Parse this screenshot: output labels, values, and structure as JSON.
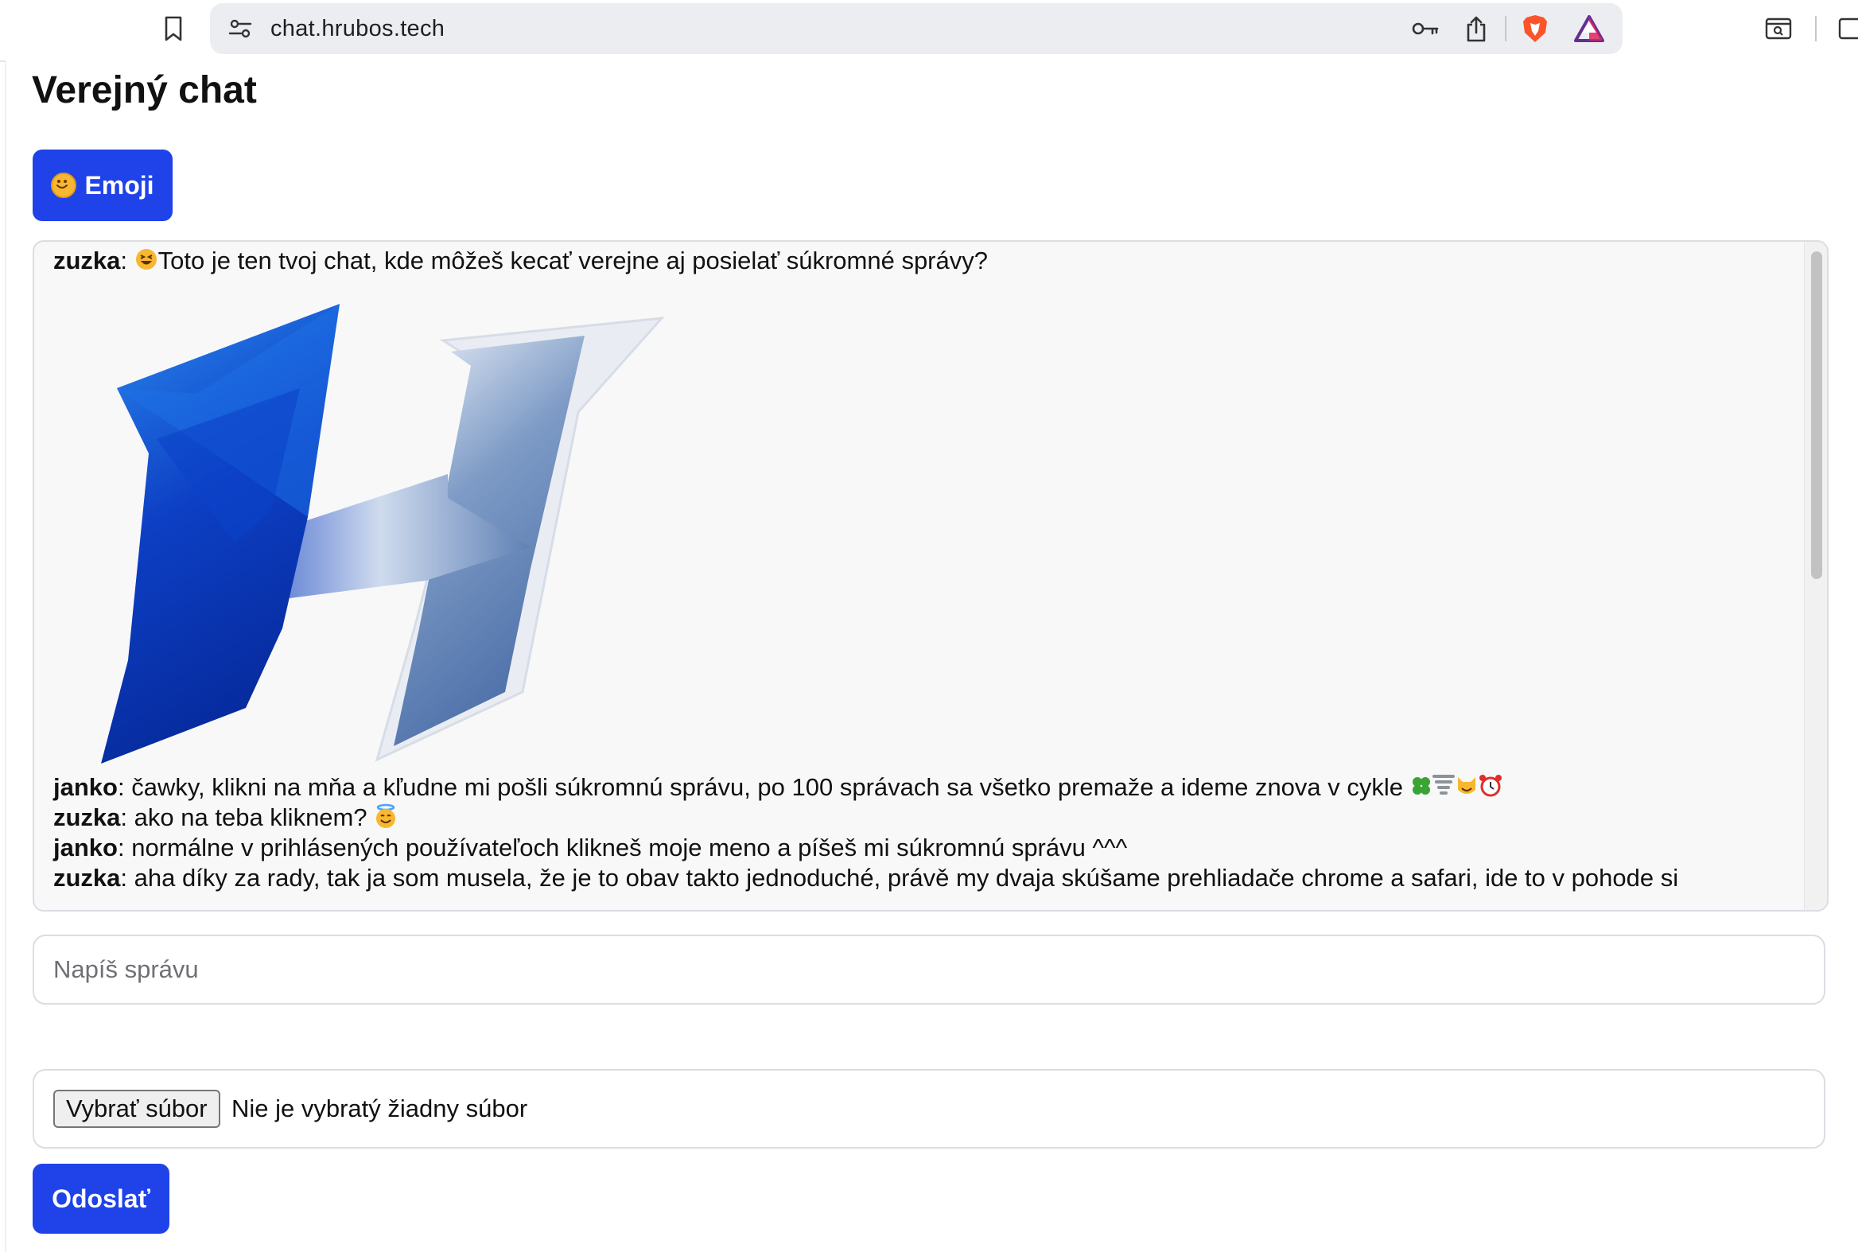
{
  "browser": {
    "url": "chat.hrubos.tech"
  },
  "page": {
    "title": "Verejný chat",
    "emoji_button_label": "Emoji",
    "messages": [
      {
        "user": "zuzka",
        "text": "Toto je ten tvoj chat, kde môžeš kecať verejne aj posielať súkromné správy?",
        "leading_emoji": "laughing-face"
      },
      {
        "user": "janko",
        "text": "čawky, klikni na mňa a kľudne mi pošli súkromnú správu, po 100 správach sa všetko premaže a ideme znova v cykle",
        "trailing_emojis": [
          "four-leaf-clover",
          "tornado",
          "smiling-cat",
          "alarm-clock"
        ]
      },
      {
        "user": "zuzka",
        "text": "ako na teba kliknem?",
        "trailing_emojis": [
          "halo-face"
        ]
      },
      {
        "user": "janko",
        "text": "normálne v prihlásených používateľoch klikneš moje meno a píšeš mi súkromnú správu ^^^"
      },
      {
        "user": "zuzka",
        "text": "aha díky za rady, tak ja som musela, že je to obav takto jednoduché, právě my dvaja skúšame prehliadače chrome a safari, ide to v pohode si"
      }
    ],
    "message_input_placeholder": "Napíš správu",
    "file_button_label": "Vybrať súbor",
    "file_status": "Nie je vybratý žiadny súbor",
    "send_button_label": "Odoslať"
  },
  "colors": {
    "accent": "#1f43e8",
    "border": "#dcdde4",
    "chat_bg": "#f8f8f8"
  }
}
